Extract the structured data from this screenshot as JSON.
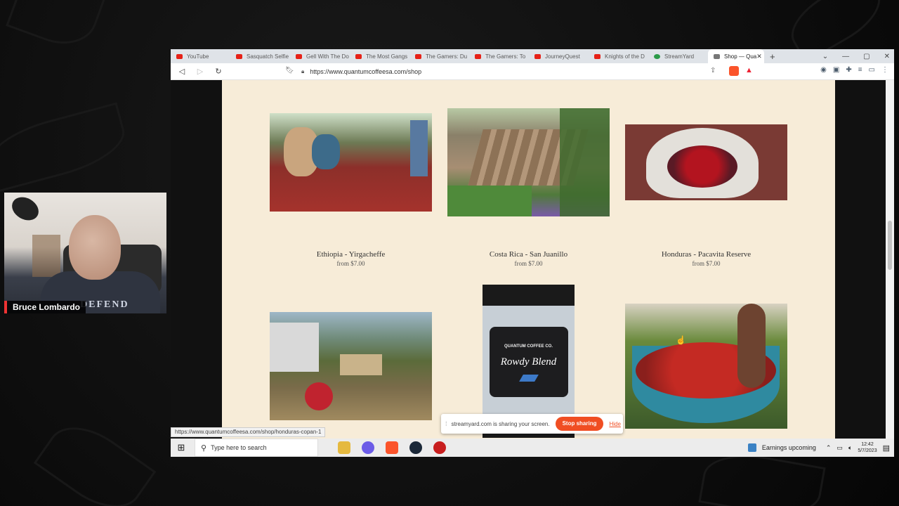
{
  "webcam": {
    "name": "Bruce Lombardo",
    "shirt_text": "DEFEND"
  },
  "browser": {
    "tabs": [
      {
        "label": "YouTube",
        "icon": "youtube-icon"
      },
      {
        "label": "Sasquatch Selfie",
        "icon": "youtube-icon"
      },
      {
        "label": "Gell With The Do",
        "icon": "youtube-icon"
      },
      {
        "label": "The Most Gangs",
        "icon": "youtube-icon"
      },
      {
        "label": "The Gamers: Du",
        "icon": "youtube-icon"
      },
      {
        "label": "The Gamers: To",
        "icon": "youtube-icon"
      },
      {
        "label": "JourneyQuest",
        "icon": "youtube-icon"
      },
      {
        "label": "Knights of the D",
        "icon": "youtube-icon"
      },
      {
        "label": "StreamYard",
        "icon": "streamyard-icon"
      },
      {
        "label": "Shop — Qua",
        "icon": "shop-icon",
        "active": true
      }
    ],
    "new_tab": "+",
    "url": "https://www.quantumcoffeesa.com/shop",
    "status_url": "https://www.quantumcoffeesa.com/shop/honduras-copan-1"
  },
  "products": [
    {
      "name": "Ethiopia - Yirgacheffe",
      "price": "from $7.00"
    },
    {
      "name": "Costa Rica - San Juanillo",
      "price": "from $7.00"
    },
    {
      "name": "Honduras - Pacavita Reserve",
      "price": "from $7.00"
    },
    {
      "name": "",
      "price": ""
    },
    {
      "name": "",
      "price": ""
    },
    {
      "name": "",
      "price": ""
    }
  ],
  "bag_label": {
    "brand": "QUANTUM COFFEE CO.",
    "blend": "Rowdy Blend"
  },
  "share_banner": {
    "message": "streamyard.com is sharing your screen.",
    "stop_label": "Stop sharing",
    "hide_label": "Hide"
  },
  "taskbar": {
    "search_placeholder": "Type here to search",
    "news": "Earnings upcoming",
    "time": "12:42",
    "date": "5/7/2023"
  }
}
